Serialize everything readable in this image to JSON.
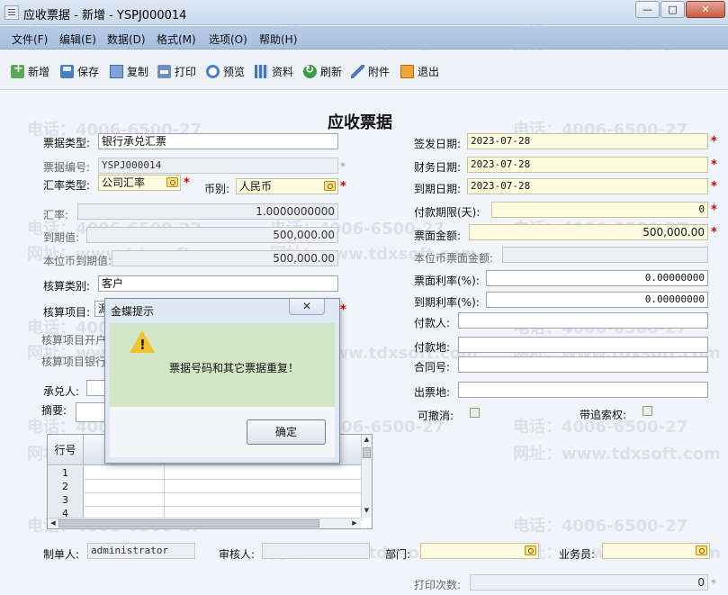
{
  "window": {
    "title": "应收票据 - 新增 - YSPJ000014",
    "min_glyph": "—",
    "max_glyph": "□",
    "close_glyph": "✕"
  },
  "menu": [
    "文件(F)",
    "编辑(E)",
    "数据(D)",
    "格式(M)",
    "选项(O)",
    "帮助(H)"
  ],
  "toolbar": {
    "add": "新增",
    "save": "保存",
    "copy": "复制",
    "print": "打印",
    "preview": "预览",
    "data": "资料",
    "refresh": "刷新",
    "attach": "附件",
    "exit": "退出"
  },
  "form": {
    "title": "应收票据",
    "bill_type": {
      "label": "票据类型:",
      "value": "银行承兑汇票"
    },
    "bill_no": {
      "label": "票据编号:",
      "value": "YSPJ000014"
    },
    "rate_type": {
      "label": "汇率类型:",
      "value": "公司汇率"
    },
    "currency": {
      "label": "币别:",
      "value": "人民币"
    },
    "exchange_rate": {
      "label": "汇率:",
      "value": "1.0000000000"
    },
    "maturity_value": {
      "label": "到期值:",
      "value": "500,000.00"
    },
    "base_maturity_value": {
      "label": "本位币到期值:",
      "value": "500,000.00"
    },
    "account_category": {
      "label": "核算类别:",
      "value": "客户"
    },
    "account_item": {
      "label": "核算项目:",
      "value": "源"
    },
    "account_bank": {
      "label": "核算项目开户"
    },
    "account_bank_no": {
      "label": "核算项目银行"
    },
    "acceptor": {
      "label": "承兑人:"
    },
    "summary": {
      "label": "摘要:"
    },
    "issue_date": {
      "label": "签发日期:",
      "value": "2023-07-28"
    },
    "finance_date": {
      "label": "财务日期:",
      "value": "2023-07-28"
    },
    "due_date": {
      "label": "到期日期:",
      "value": "2023-07-28"
    },
    "payment_term": {
      "label": "付款期限(天):",
      "value": "0"
    },
    "face_amount": {
      "label": "票面金额:",
      "value": "500,000.00"
    },
    "base_face_amount": {
      "label": "本位币票面金额:",
      "value": ""
    },
    "face_rate": {
      "label": "票面利率(%):",
      "value": "0.00000000"
    },
    "maturity_rate": {
      "label": "到期利率(%):",
      "value": "0.00000000"
    },
    "payer": {
      "label": "付款人:"
    },
    "payer_address": {
      "label": "付款地:"
    },
    "contract_no": {
      "label": "合同号:"
    },
    "issue_place": {
      "label": "出票地:"
    },
    "revocable": {
      "label": "可撤消:"
    },
    "recourse": {
      "label": "带追索权:"
    },
    "maker": {
      "label": "制单人:",
      "value": "administrator"
    },
    "reviewer": {
      "label": "审核人:"
    },
    "department": {
      "label": "部门:"
    },
    "salesman": {
      "label": "业务员:"
    },
    "print_count": {
      "label": "打印次数:",
      "value": "0"
    },
    "required_mark": "*",
    "optional_mark": "*"
  },
  "grid": {
    "header_row_no": "行号",
    "rows": [
      "1",
      "2",
      "3",
      "4"
    ]
  },
  "dialog": {
    "title": "金蝶提示",
    "close_glyph": "✕",
    "message": "票据号码和其它票据重复！",
    "ok_label": "确定"
  },
  "watermark": {
    "phone": "电话：4006-6500-27",
    "site": "网址：www.tdxsoft.com"
  }
}
